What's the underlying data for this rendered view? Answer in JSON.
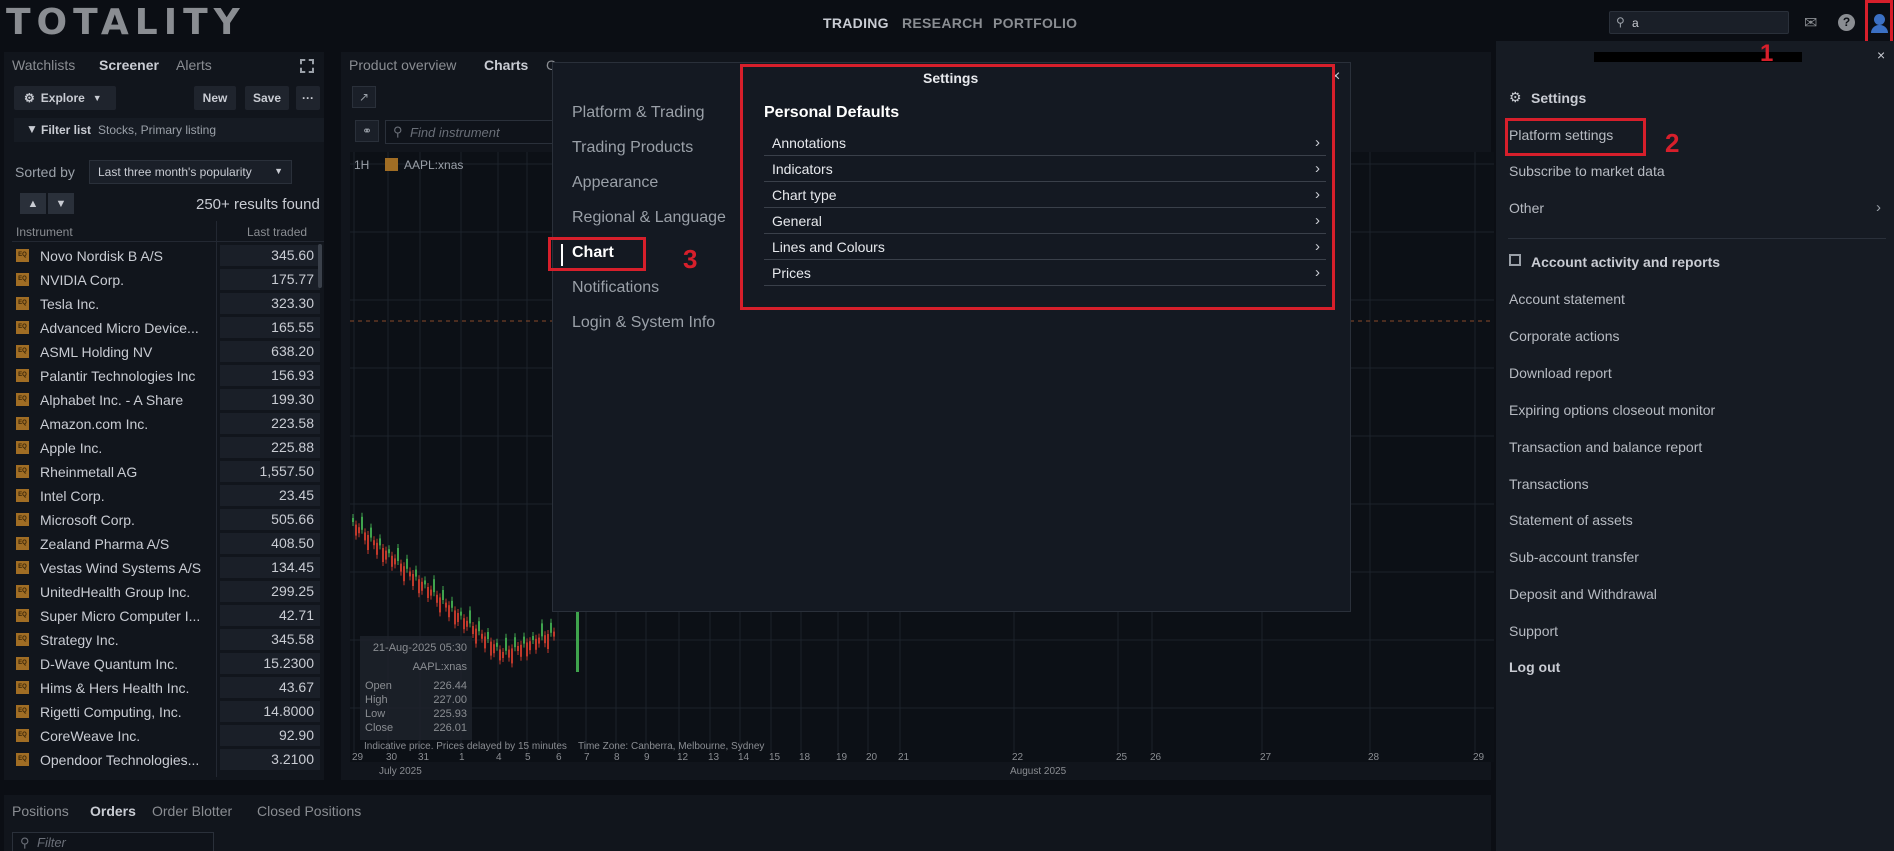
{
  "header": {
    "logo": "TOTALITY",
    "nav": [
      "TRADING",
      "RESEARCH",
      "PORTFOLIO"
    ],
    "search_value": "a"
  },
  "left_panel": {
    "tabs": [
      "Watchlists",
      "Screener",
      "Alerts"
    ],
    "explore_label": "Explore",
    "new_label": "New",
    "save_label": "Save",
    "more_label": "···",
    "filter_label": "Filter list",
    "filter_value": "Stocks, Primary listing",
    "sorted_by_label": "Sorted by",
    "sort_value": "Last three month's popularity",
    "results": "250+ results found",
    "col_instrument": "Instrument",
    "col_last_traded": "Last traded",
    "instruments": [
      {
        "name": "Novo Nordisk B A/S",
        "price": "345.60"
      },
      {
        "name": "NVIDIA Corp.",
        "price": "175.77"
      },
      {
        "name": "Tesla Inc.",
        "price": "323.30"
      },
      {
        "name": "Advanced Micro Device...",
        "price": "165.55"
      },
      {
        "name": "ASML Holding NV",
        "price": "638.20"
      },
      {
        "name": "Palantir Technologies Inc",
        "price": "156.93"
      },
      {
        "name": "Alphabet Inc. - A Share",
        "price": "199.30"
      },
      {
        "name": "Amazon.com Inc.",
        "price": "223.58"
      },
      {
        "name": "Apple Inc.",
        "price": "225.88"
      },
      {
        "name": "Rheinmetall AG",
        "price": "1,557.50"
      },
      {
        "name": "Intel Corp.",
        "price": "23.45"
      },
      {
        "name": "Microsoft Corp.",
        "price": "505.66"
      },
      {
        "name": "Zealand Pharma A/S",
        "price": "408.50"
      },
      {
        "name": "Vestas Wind Systems A/S",
        "price": "134.45"
      },
      {
        "name": "UnitedHealth Group Inc.",
        "price": "299.25"
      },
      {
        "name": "Super Micro Computer I...",
        "price": "42.71"
      },
      {
        "name": "Strategy Inc.",
        "price": "345.58"
      },
      {
        "name": "D-Wave Quantum Inc.",
        "price": "15.2300"
      },
      {
        "name": "Hims & Hers Health Inc.",
        "price": "43.67"
      },
      {
        "name": "Rigetti Computing, Inc.",
        "price": "14.8000"
      },
      {
        "name": "CoreWeave Inc.",
        "price": "92.90"
      },
      {
        "name": "Opendoor Technologies...",
        "price": "3.2100"
      }
    ]
  },
  "center": {
    "tabs": [
      "Product overview",
      "Charts",
      "C"
    ],
    "find_placeholder": "Find instrument",
    "interval": "1H",
    "symbol": "AAPL:xnas",
    "ohlc": {
      "date": "21-Aug-2025 05:30",
      "symbol": "AAPL:xnas",
      "open_label": "Open",
      "open": "226.44",
      "high_label": "High",
      "high": "227.00",
      "low_label": "Low",
      "low": "225.93",
      "close_label": "Close",
      "close": "226.01"
    },
    "footnote": "Indicative price. Prices delayed by 15 minutes",
    "timezone": "Time Zone: Canberra, Melbourne, Sydney",
    "x_ticks": [
      "29",
      "30",
      "31",
      "1",
      "4",
      "5",
      "6",
      "7",
      "8",
      "9",
      "12",
      "13",
      "14",
      "15",
      "18",
      "19",
      "20",
      "21",
      "22",
      "25",
      "26",
      "27",
      "28",
      "29"
    ],
    "month_july": "July 2025",
    "month_august": "August 2025"
  },
  "modal": {
    "title": "Settings",
    "close": "×",
    "menu": [
      "Platform & Trading",
      "Trading Products",
      "Appearance",
      "Regional & Language",
      "Chart",
      "Notifications",
      "Login & System Info"
    ],
    "section_title": "Personal Defaults",
    "items": [
      "Annotations",
      "Indicators",
      "Chart type",
      "General",
      "Lines and Colours",
      "Prices"
    ]
  },
  "drawer": {
    "close": "×",
    "settings_title": "Settings",
    "settings_items": [
      "Platform settings",
      "Subscribe to market data",
      "Other"
    ],
    "account_title": "Account activity and reports",
    "account_items": [
      "Account statement",
      "Corporate actions",
      "Download report",
      "Expiring options closeout monitor",
      "Transaction and balance report",
      "Transactions",
      "Statement of assets",
      "Sub-account transfer",
      "Deposit and Withdrawal",
      "Support"
    ],
    "logout": "Log out"
  },
  "annotations": [
    "1",
    "2",
    "3"
  ],
  "bottom": {
    "tabs": [
      "Positions",
      "Orders",
      "Order Blotter",
      "Closed Positions"
    ],
    "filter_placeholder": "Filter"
  },
  "colors": {
    "accent_red": "#d71f2b",
    "user_icon": "#3b70c4",
    "equity_icon": "#a06d24"
  }
}
